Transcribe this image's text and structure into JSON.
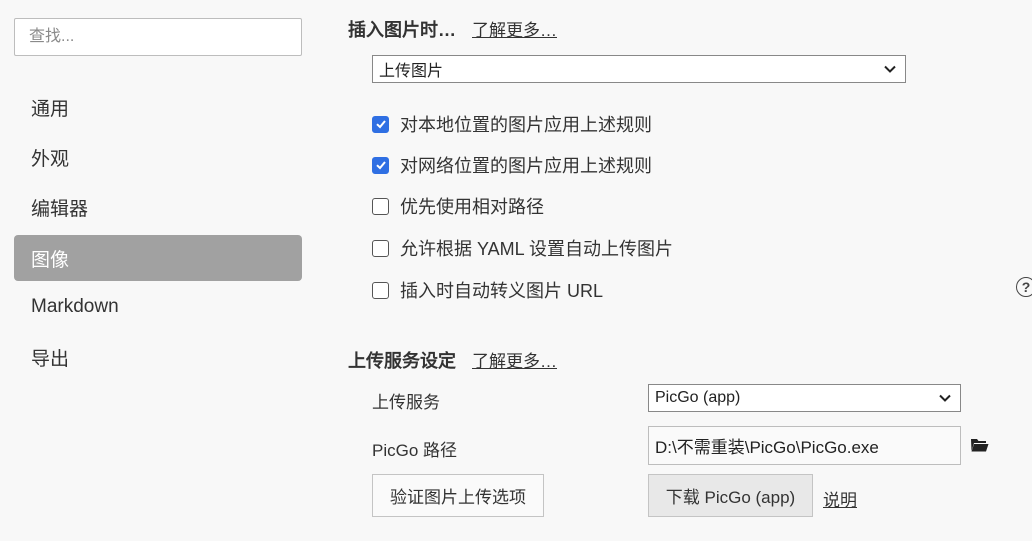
{
  "sidebar": {
    "search_placeholder": "查找...",
    "items": [
      {
        "label": "通用"
      },
      {
        "label": "外观"
      },
      {
        "label": "编辑器"
      },
      {
        "label": "图像"
      },
      {
        "label": "Markdown"
      },
      {
        "label": "导出"
      }
    ],
    "active_index": 3
  },
  "insert_section": {
    "title": "插入图片时…",
    "learn_more": "了解更多…",
    "action_select": "上传图片",
    "options": [
      {
        "label": "对本地位置的图片应用上述规则",
        "checked": true
      },
      {
        "label": "对网络位置的图片应用上述规则",
        "checked": true
      },
      {
        "label": "优先使用相对路径",
        "checked": false
      },
      {
        "label": "允许根据 YAML 设置自动上传图片",
        "checked": false
      },
      {
        "label": "插入时自动转义图片 URL",
        "checked": false
      }
    ],
    "help_icon": "?"
  },
  "upload_section": {
    "title": "上传服务设定",
    "learn_more": "了解更多…",
    "service_label": "上传服务",
    "service_value": "PicGo (app)",
    "path_label": "PicGo 路径",
    "path_value": "D:\\不需重装\\PicGo\\PicGo.exe",
    "verify_button": "验证图片上传选项",
    "download_button": "下载 PicGo (app)",
    "help_link": "说明"
  },
  "colors": {
    "accent": "#2f6fe3",
    "sidebar_active_bg": "#a1a1a1",
    "background": "#f8f8f8"
  }
}
